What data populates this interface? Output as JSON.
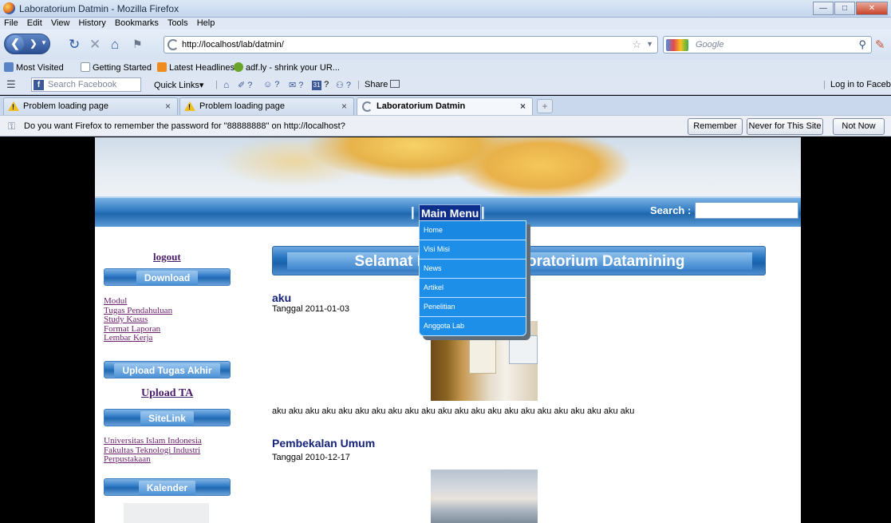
{
  "window": {
    "title": "Laboratorium Datmin - Mozilla Firefox",
    "controls": [
      "minimize",
      "maximize",
      "close"
    ]
  },
  "menu": [
    "File",
    "Edit",
    "View",
    "History",
    "Bookmarks",
    "Tools",
    "Help"
  ],
  "navigation": {
    "url": "http://localhost/lab/datmin/",
    "search_placeholder": "Google"
  },
  "bookmarks": [
    {
      "label": "Most Visited",
      "icon": "most-visited-icon"
    },
    {
      "label": "Getting Started",
      "icon": "page-icon"
    },
    {
      "label": "Latest Headlines",
      "icon": "rss-icon"
    },
    {
      "label": "adf.ly - shrink your UR...",
      "icon": "adfly-icon"
    }
  ],
  "facebook_toolbar": {
    "search_placeholder": "Search Facebook",
    "quick_links": "Quick Links",
    "share": "Share",
    "login": "Log in to Facebo",
    "counters": [
      "?",
      "?",
      "?",
      "?",
      "?"
    ],
    "calendar_day": "31"
  },
  "tabs": [
    {
      "label": "Problem loading page",
      "icon": "warning-icon",
      "active": false
    },
    {
      "label": "Problem loading page",
      "icon": "warning-icon",
      "active": false
    },
    {
      "label": "Laboratorium Datmin",
      "icon": "loading-icon",
      "active": true
    }
  ],
  "notification": {
    "message": "Do you want Firefox to remember the password for \"88888888\" on http://localhost?",
    "buttons": [
      "Remember",
      "Never for This Site",
      "Not Now"
    ]
  },
  "site": {
    "menu": {
      "main_menu_label": "Main Menu",
      "search_label": "Search :",
      "dropdown_items": [
        "Home",
        "Visi Misi",
        "News",
        "Artikel",
        "Penelitian",
        "Anggota Lab"
      ]
    },
    "sidebar": {
      "logout": "logout",
      "download_label": "Download",
      "download_links": [
        "Modul",
        "Tugas Pendahuluan",
        "Study Kasus",
        "Format Laporan",
        "Lembar Kerja"
      ],
      "upload_tugas_label": "Upload Tugas Akhir",
      "upload_ta": "Upload TA",
      "sitelink_label": "SiteLink",
      "site_links": [
        "Universitas Islam Indonesia",
        "Fakultas Teknologi Industri",
        "Perpustakaan"
      ],
      "kalender_label": "Kalender"
    },
    "welcome_left": "Selamat D",
    "welcome_right": "boratorium Datamining",
    "posts": [
      {
        "title": "aku",
        "date": "Tanggal 2011-01-03",
        "body": "aku aku aku aku aku aku aku aku aku aku aku aku aku aku aku aku aku aku aku aku aku aku"
      },
      {
        "title": "Pembekalan Umum",
        "date": "Tanggal 2010-12-17",
        "body": ""
      }
    ]
  }
}
